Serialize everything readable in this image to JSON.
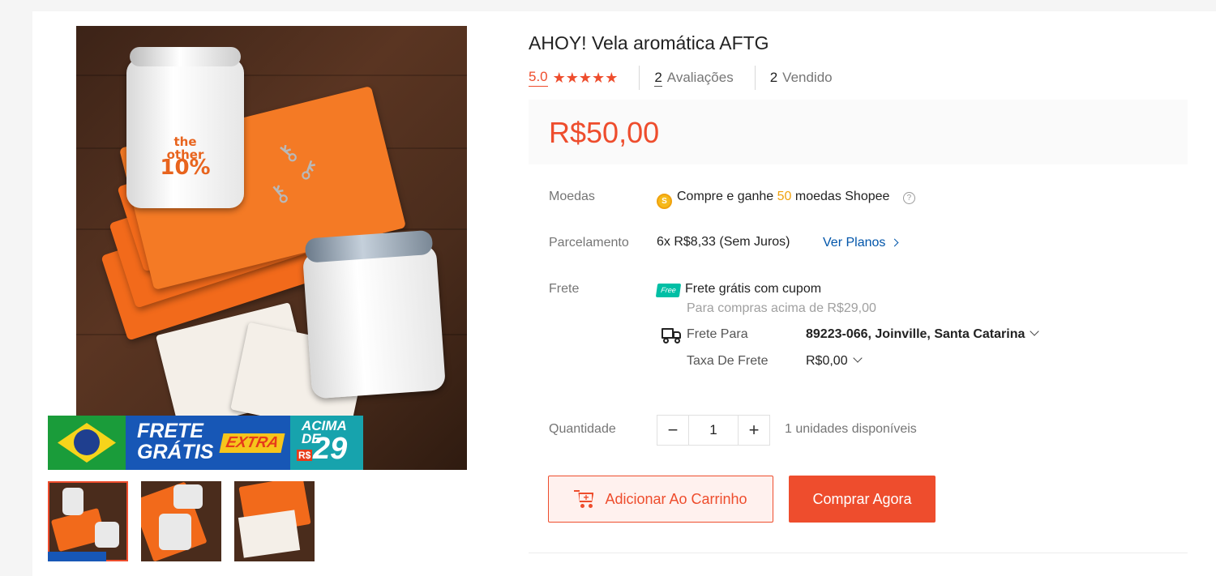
{
  "product": {
    "title": "AHOY! Vela aromática AFTG",
    "rating": "5.0",
    "stars": "★★★★★",
    "reviews_count": "2",
    "reviews_label": "Avaliações",
    "sold_count": "2",
    "sold_label": "Vendido",
    "price": "R$50,00",
    "rating_value": 5.0,
    "thumbnail_count": 3
  },
  "gallery": {
    "promo": {
      "frete_line1": "FRETE",
      "frete_line2": "GRÁTIS",
      "extra": "EXTRA",
      "acima_line1": "ACIMA",
      "acima_line2": "DE",
      "currency": "R$",
      "amount": "29"
    },
    "jar_label_line1": "the",
    "jar_label_line2": "other",
    "jar_label_line3": "10%"
  },
  "details": {
    "coins_label": "Moedas",
    "coins_text_before": "Compre e ganhe",
    "coins_amount": "50",
    "coins_text_after": "moedas Shopee",
    "installment_label": "Parcelamento",
    "installment_value": "6x R$8,33 (Sem Juros)",
    "installment_link": "Ver Planos",
    "shipping_label": "Frete",
    "free_shipping_badge": "Free",
    "free_shipping_text": "Frete grátis com cupom",
    "free_shipping_sub": "Para compras acima de R$29,00",
    "ship_to_label": "Frete Para",
    "ship_to_value": "89223-066, Joinville, Santa Catarina",
    "ship_fee_label": "Taxa De Frete",
    "ship_fee_value": "R$0,00",
    "quantity_label": "Quantidade",
    "quantity_minus": "−",
    "quantity_value": "1",
    "quantity_plus": "+",
    "stock_text": "1 unidades disponíveis"
  },
  "actions": {
    "add_to_cart": "Adicionar Ao Carrinho",
    "buy_now": "Comprar Agora"
  },
  "colors": {
    "accent": "#ee4d2d",
    "coin": "#f0a20e",
    "link": "#0055aa",
    "free_badge": "#00bfa5"
  },
  "icons": [
    "star-icon",
    "coin-icon",
    "help-icon",
    "chevron-right-icon",
    "free-shipping-icon",
    "truck-icon",
    "chevron-down-icon",
    "cart-icon"
  ]
}
